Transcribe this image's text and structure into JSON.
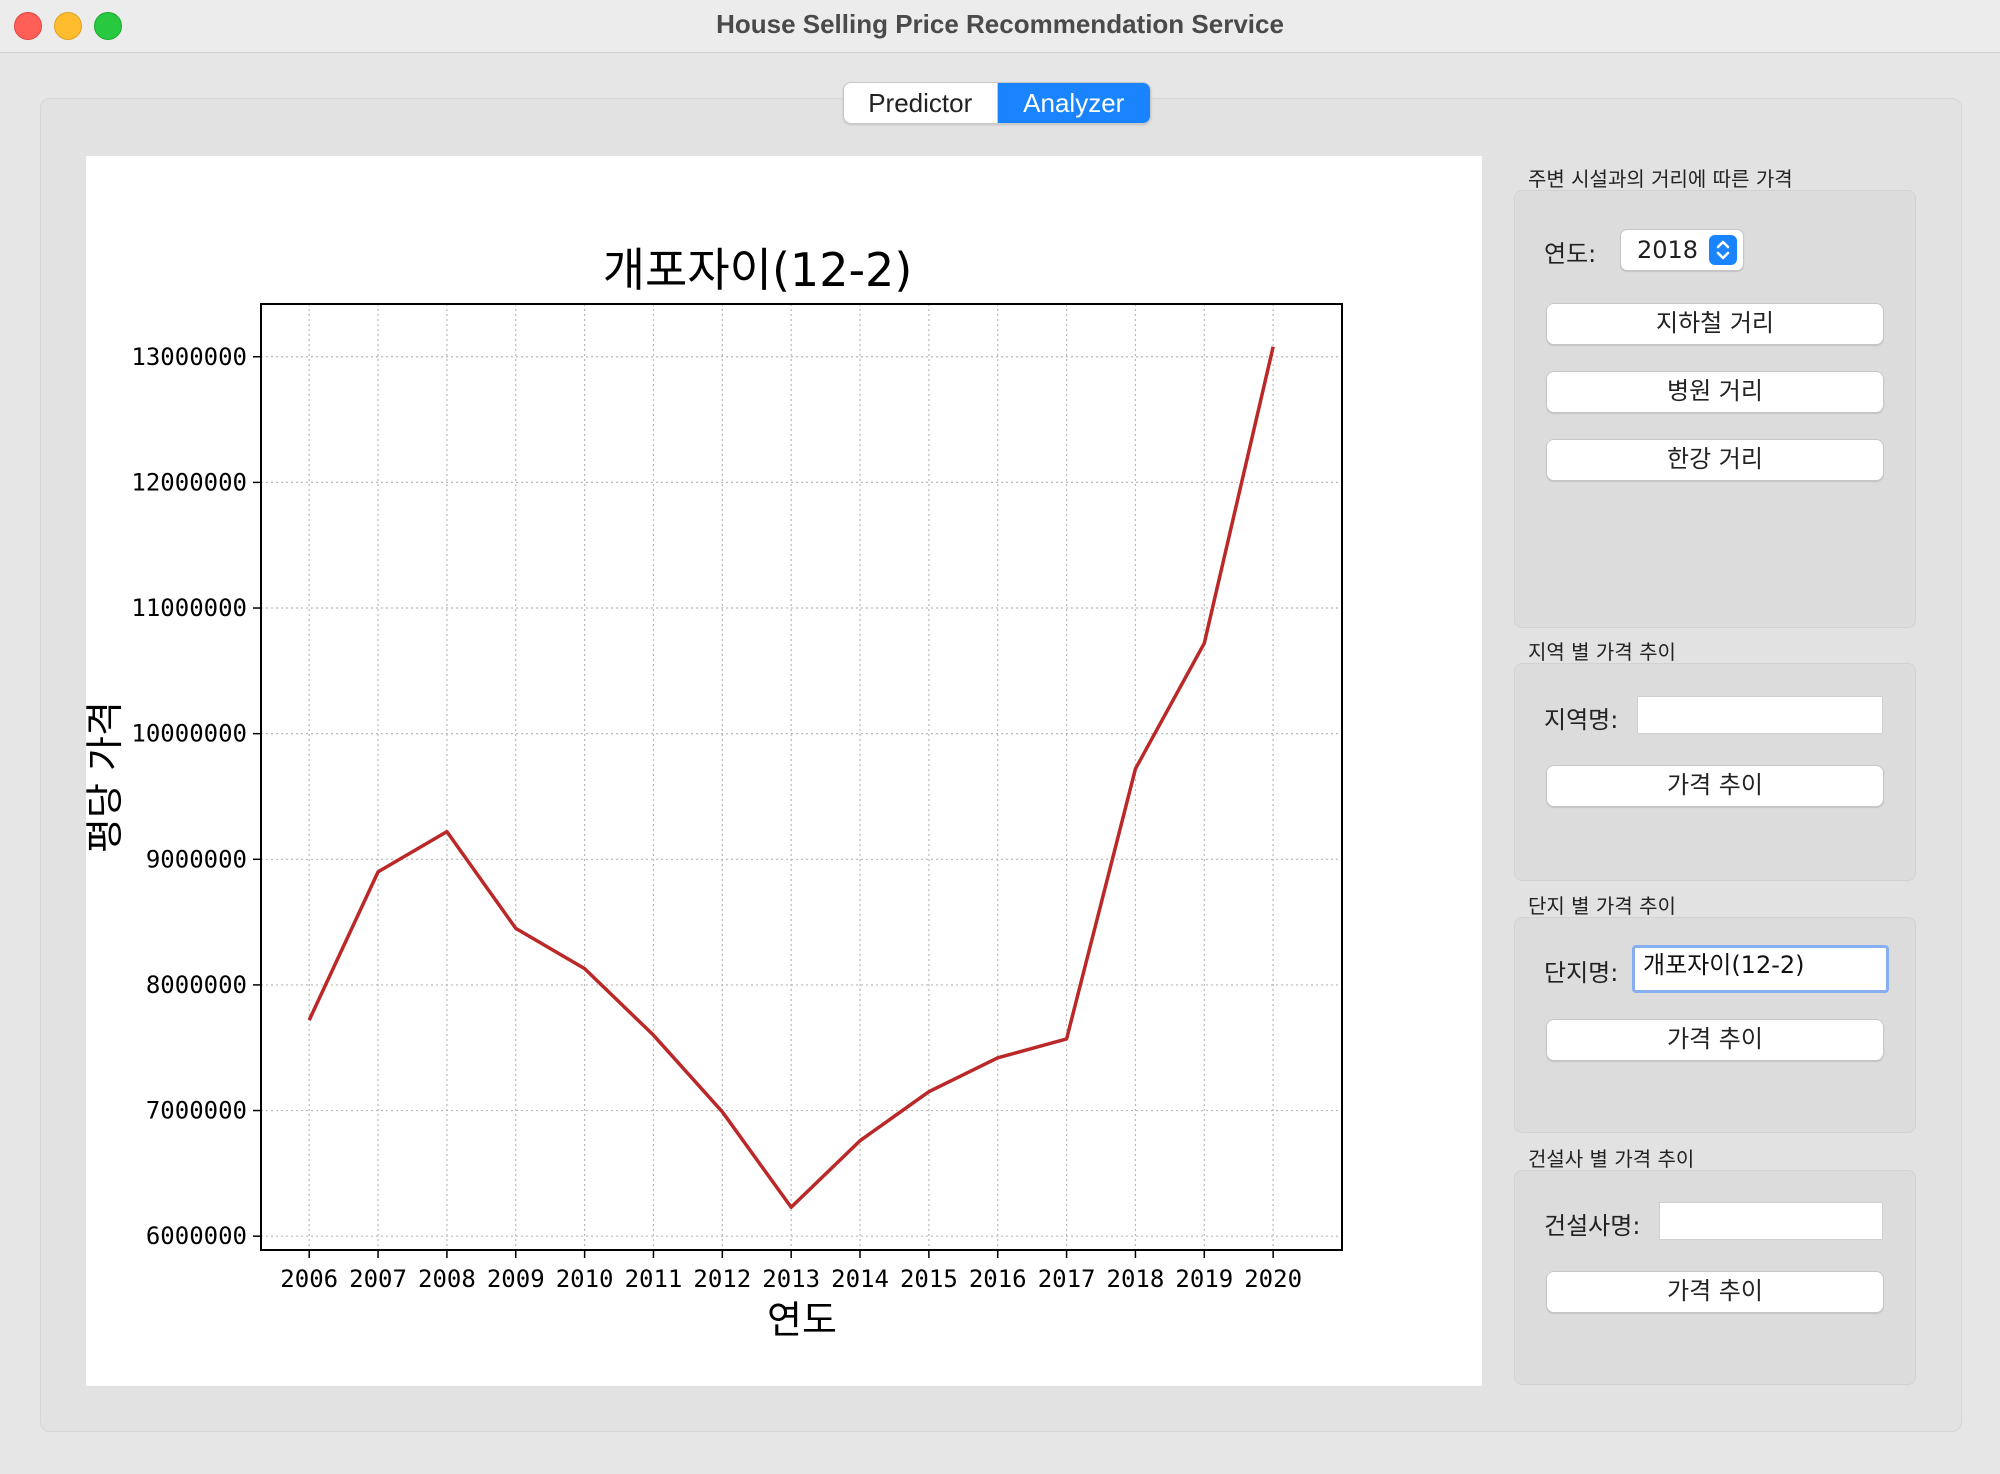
{
  "window": {
    "title": "House Selling Price Recommendation Service"
  },
  "tabs": [
    {
      "label": "Predictor",
      "active": false
    },
    {
      "label": "Analyzer",
      "active": true
    }
  ],
  "panel_distance": {
    "group_title": "주변 시설과의 거리에 따른 가격",
    "year_label": "연도:",
    "year_value": "2018",
    "buttons": [
      "지하철 거리",
      "병원 거리",
      "한강 거리"
    ]
  },
  "panel_region": {
    "group_title": "지역 별 가격 추이",
    "field_label": "지역명:",
    "field_value": "",
    "button": "가격 추이"
  },
  "panel_complex": {
    "group_title": "단지 별 가격 추이",
    "field_label": "단지명:",
    "field_value": "개포자이(12-2)",
    "button": "가격 추이"
  },
  "panel_builder": {
    "group_title": "건설사 별 가격 추이",
    "field_label": "건설사명:",
    "field_value": "",
    "button": "가격 추이"
  },
  "colors": {
    "accent": "#1a84ff",
    "line": "#bb2828",
    "focus_ring": "#86aef0"
  },
  "chart_data": {
    "type": "line",
    "title": "개포자이(12-2)",
    "xlabel": "연도",
    "ylabel": "평당 가격",
    "x": [
      2006,
      2007,
      2008,
      2009,
      2010,
      2011,
      2012,
      2013,
      2014,
      2015,
      2016,
      2017,
      2018,
      2019,
      2020
    ],
    "series": [
      {
        "values": [
          7720000,
          8900000,
          9220000,
          8450000,
          8130000,
          7600000,
          6990000,
          6230000,
          6760000,
          7150000,
          7420000,
          7570000,
          9720000,
          10720000,
          13080000
        ]
      }
    ],
    "yticks": [
      6000000,
      7000000,
      8000000,
      9000000,
      10000000,
      11000000,
      12000000,
      13000000
    ],
    "ylim": [
      5890000,
      13420000
    ],
    "xlim": [
      2005.3,
      2021.0
    ],
    "grid": true
  }
}
